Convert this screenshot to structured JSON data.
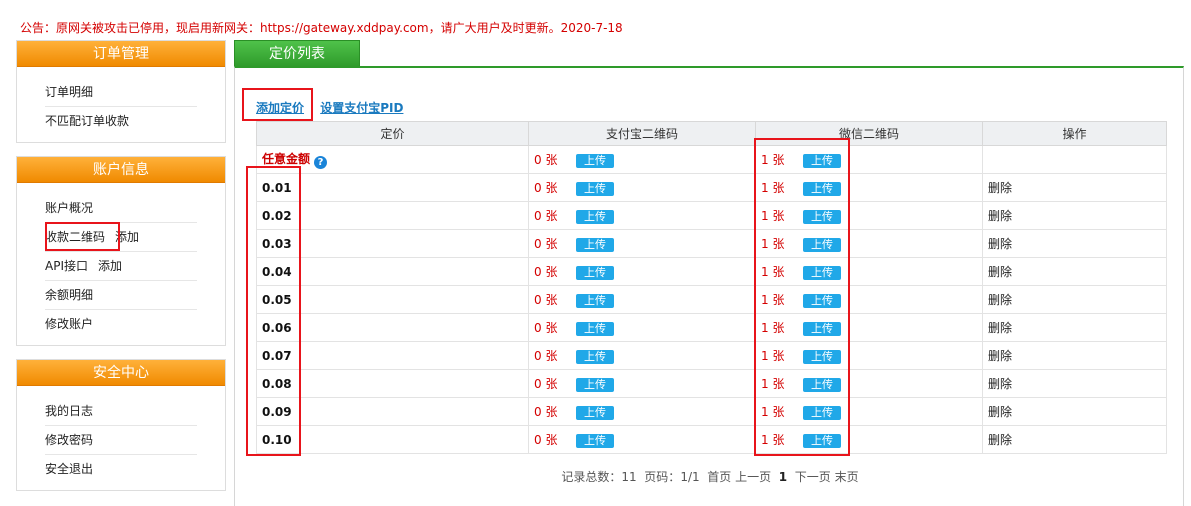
{
  "notice": "公告：原网关被攻击已停用，现启用新网关：https://gateway.xddpay.com，请广大用户及时更新。2020-7-18",
  "sidebar": {
    "order": {
      "title": "订单管理",
      "items": [
        "订单明细",
        "不匹配订单收款"
      ]
    },
    "account": {
      "title": "账户信息",
      "items": [
        {
          "label": "账户概况",
          "sub": ""
        },
        {
          "label": "收款二维码",
          "sub": "添加"
        },
        {
          "label": "API接口",
          "sub": "添加"
        },
        {
          "label": "余额明细",
          "sub": ""
        },
        {
          "label": "修改账户",
          "sub": ""
        }
      ]
    },
    "security": {
      "title": "安全中心",
      "items": [
        "我的日志",
        "修改密码",
        "安全退出"
      ]
    }
  },
  "tab": {
    "label": "定价列表"
  },
  "actions": {
    "add_price": "添加定价",
    "set_pid": "设置支付宝PID"
  },
  "table": {
    "headers": [
      "定价",
      "支付宝二维码",
      "微信二维码",
      "操作"
    ],
    "rows": [
      {
        "price": "任意金额",
        "help": "?",
        "alipay": "0 张",
        "alipay_btn": "上传",
        "wechat": "1 张",
        "wechat_btn": "上传",
        "op": ""
      },
      {
        "price": "0.01",
        "alipay": "0 张",
        "alipay_btn": "上传",
        "wechat": "1 张",
        "wechat_btn": "上传",
        "op": "删除"
      },
      {
        "price": "0.02",
        "alipay": "0 张",
        "alipay_btn": "上传",
        "wechat": "1 张",
        "wechat_btn": "上传",
        "op": "删除"
      },
      {
        "price": "0.03",
        "alipay": "0 张",
        "alipay_btn": "上传",
        "wechat": "1 张",
        "wechat_btn": "上传",
        "op": "删除"
      },
      {
        "price": "0.04",
        "alipay": "0 张",
        "alipay_btn": "上传",
        "wechat": "1 张",
        "wechat_btn": "上传",
        "op": "删除"
      },
      {
        "price": "0.05",
        "alipay": "0 张",
        "alipay_btn": "上传",
        "wechat": "1 张",
        "wechat_btn": "上传",
        "op": "删除"
      },
      {
        "price": "0.06",
        "alipay": "0 张",
        "alipay_btn": "上传",
        "wechat": "1 张",
        "wechat_btn": "上传",
        "op": "删除"
      },
      {
        "price": "0.07",
        "alipay": "0 张",
        "alipay_btn": "上传",
        "wechat": "1 张",
        "wechat_btn": "上传",
        "op": "删除"
      },
      {
        "price": "0.08",
        "alipay": "0 张",
        "alipay_btn": "上传",
        "wechat": "1 张",
        "wechat_btn": "上传",
        "op": "删除"
      },
      {
        "price": "0.09",
        "alipay": "0 张",
        "alipay_btn": "上传",
        "wechat": "1 张",
        "wechat_btn": "上传",
        "op": "删除"
      },
      {
        "price": "0.10",
        "alipay": "0 张",
        "alipay_btn": "上传",
        "wechat": "1 张",
        "wechat_btn": "上传",
        "op": "删除"
      }
    ]
  },
  "pager": {
    "total_label": "记录总数：",
    "total": "11",
    "page_label": "页码：",
    "page": "1/1",
    "first": "首页",
    "prev": "上一页",
    "current": "1",
    "next": "下一页",
    "last": "末页"
  },
  "colors": {
    "accent_orange": "#f08a00",
    "accent_green": "#2e9a2a",
    "link_blue": "#1a7abf",
    "upload_blue": "#20a8e8",
    "alert_red": "#d40000",
    "highlight_red": "#e8141b"
  }
}
